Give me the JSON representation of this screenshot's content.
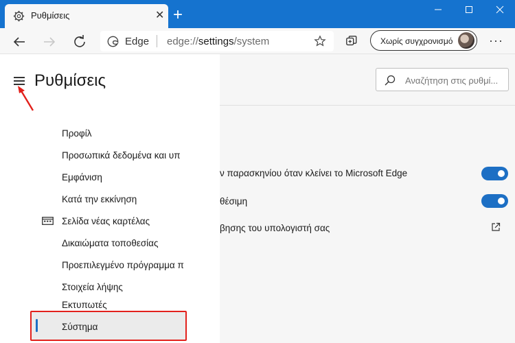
{
  "tab": {
    "title": "Ρυθμίσεις",
    "icon": "gear-icon"
  },
  "toolbar": {
    "engine_label": "Edge",
    "url_scheme": "edge://",
    "url_host": "settings",
    "url_path": "/system",
    "sync_label": "Χωρίς συγχρονισμό",
    "more_label": "···"
  },
  "sidebar": {
    "title": "Ρυθμίσεις",
    "items": [
      {
        "label": "Προφίλ"
      },
      {
        "label": "Προσωπικά δεδομένα και υπ"
      },
      {
        "label": "Εμφάνιση"
      },
      {
        "label": "Κατά την εκκίνηση"
      },
      {
        "label": "Σελίδα νέας καρτέλας",
        "icon": "new-tab-page-icon"
      },
      {
        "label": "Δικαιώματα τοποθεσίας"
      },
      {
        "label": "Προεπιλεγμένο πρόγραμμα π"
      },
      {
        "label": "Στοιχεία λήψης"
      },
      {
        "label": "Εκτυπωτές"
      },
      {
        "label": "Σύστημα",
        "selected": true
      }
    ]
  },
  "content": {
    "search_placeholder": "Αναζήτηση στις ρυθμί...",
    "rows": [
      {
        "label": "ν παρασκηνίου όταν κλείνει το Microsoft Edge",
        "toggle": "on"
      },
      {
        "label": "θέσιμη",
        "toggle": "on"
      },
      {
        "label": "βησης του υπολογιστή σας",
        "link": "external-link-icon"
      }
    ]
  },
  "colors": {
    "accent": "#1573cf",
    "toggle_on": "#1d6fc4",
    "annotation": "#e2201b"
  }
}
